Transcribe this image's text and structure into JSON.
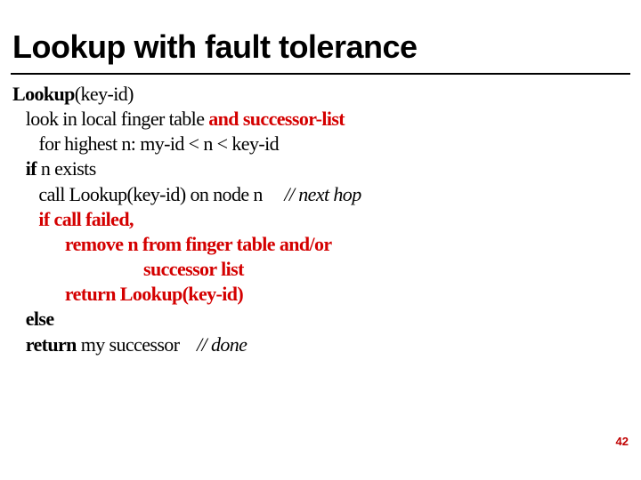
{
  "title": "Lookup with fault tolerance",
  "algo": {
    "l1_pre": "Lookup",
    "l1_post": "(key-id)",
    "l2_pre": "   look in local finger table ",
    "l2_red": "and successor-list",
    "l3": "      for highest n: my-id < n < key-id",
    "l4_pre": "   ",
    "l4_b": "if ",
    "l4_post": "n exists",
    "l5_pre": "      call Lookup(key-id) on node n     ",
    "l5_i": "// next hop",
    "l6_pre": "      ",
    "l6_red": "if call failed,",
    "l7_pre": "            ",
    "l7_red": "remove n from finger table and/or",
    "l8_pre": "                              ",
    "l8_red": "successor list",
    "l9_pre": "            ",
    "l9_red": "return Lookup(key-id)",
    "l10_pre": "   ",
    "l10_b": "else ",
    "l11_pre": "   ",
    "l11_b": "return ",
    "l11_post": "my successor    ",
    "l11_i": "// done"
  },
  "pagenum": "42"
}
